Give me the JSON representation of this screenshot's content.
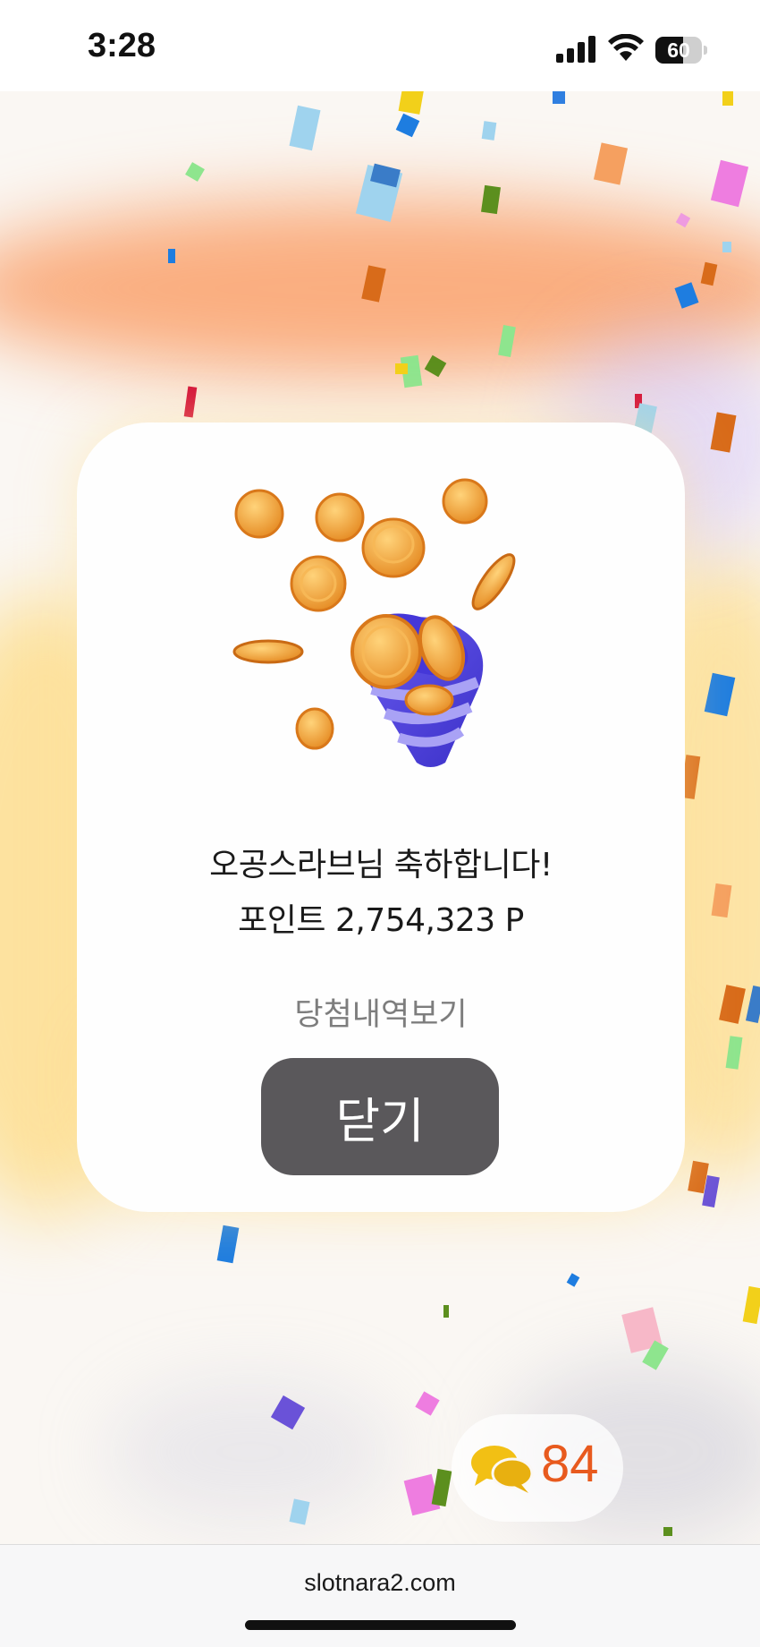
{
  "status_bar": {
    "time": "3:28",
    "battery_level": "60",
    "battery_fraction": 0.6
  },
  "modal": {
    "congrats_text": "오공스라브님 축하합니다!",
    "points_text": "포인트 2,754,323 P",
    "history_link": "당첨내역보기",
    "close_label": "닫기",
    "illustration": "party-popper-coins-icon"
  },
  "chat_badge": {
    "icon": "chat-bubbles-icon",
    "count": "84",
    "count_color": "#e85a1e",
    "icon_color": "#f2c014"
  },
  "url_bar": {
    "url": "slotnara2.com"
  },
  "colors": {
    "close_button": "#5a585b",
    "popper_purple": "#5b4ee6",
    "coin_gold": "#f2a83a"
  }
}
